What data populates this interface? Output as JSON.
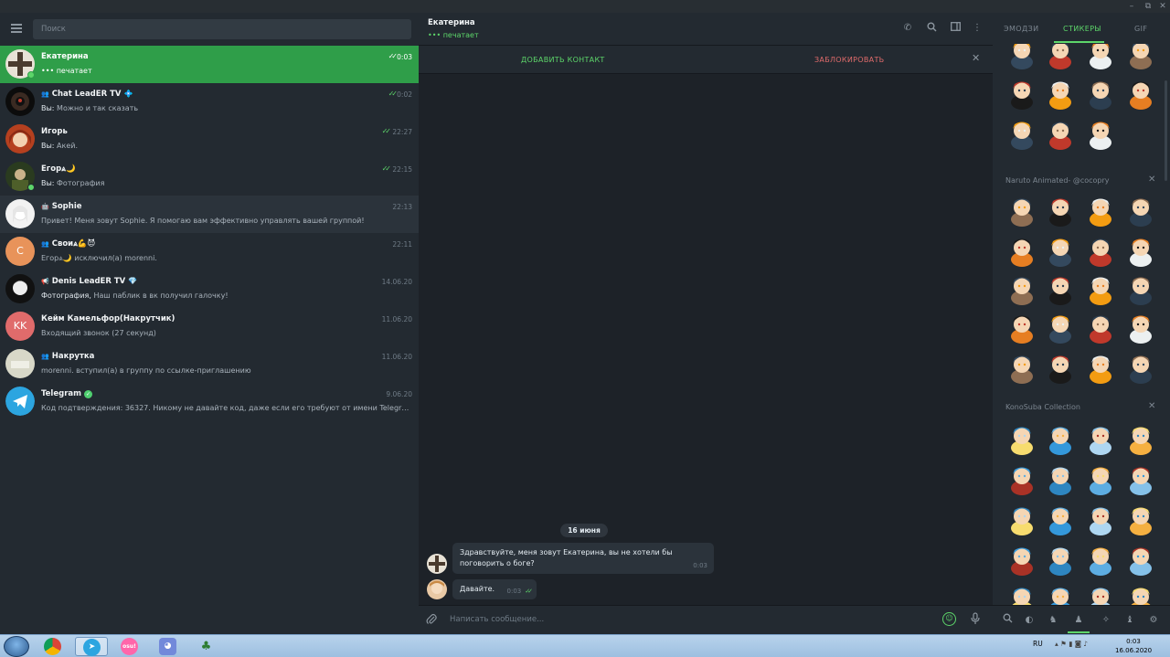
{
  "window": {
    "minimize": "–",
    "maximize": "⧉",
    "close": "✕"
  },
  "sidebar": {
    "search_placeholder": "Поиск",
    "chats": [
      {
        "name": "Екатерина",
        "preview": "••• печатает",
        "time": "0:03",
        "read": true,
        "online": true,
        "active": true,
        "avatar": "cross"
      },
      {
        "name": "Chat LeadER TV",
        "name_suffix": "💠",
        "group": true,
        "preview_me": "Вы:",
        "preview": "Можно и так сказать",
        "time": "0:02",
        "read": true
      },
      {
        "name": "Игорь",
        "preview_me": "Вы:",
        "preview": "Акей.",
        "time": "22:27",
        "read": true
      },
      {
        "name": "Егор⩓🌙",
        "preview_me": "Вы:",
        "preview": "Фотография",
        "time": "22:15",
        "read": true,
        "online": true
      },
      {
        "name": "Sophie",
        "bot": true,
        "preview": "Привет! Меня зовут Sophie. Я помогаю вам эффективно управлять вашей группой!",
        "time": "22:13",
        "hover": true
      },
      {
        "name": "Свои⩓💪😈",
        "group": true,
        "preview": "Егор⩓🌙 исключил(а) morenni.",
        "time": "22:11",
        "avatar_letter": "С",
        "avatar_color": "#e8935a"
      },
      {
        "name": "Denis LeadER TV",
        "name_suffix": "💎",
        "channel": true,
        "preview_me": "Фотография,",
        "preview": "Наш паблик в вк получил галочку!",
        "time": "14.06.20"
      },
      {
        "name": "Кейм Камельфор(Накрутчик)",
        "preview": "Входящий звонок (27 секунд)",
        "time": "11.06.20",
        "avatar_letter": "KK",
        "avatar_color": "#e06b6b"
      },
      {
        "name": "Накрутка",
        "group": true,
        "preview": "morenni. вступил(а) в группу по ссылке-приглашению",
        "time": "11.06.20"
      },
      {
        "name": "Telegram",
        "verified": true,
        "preview": "Код подтверждения: 36327. Никому не давайте код, даже если его требуют от имени Telegram! ...",
        "time": "9.06.20"
      }
    ]
  },
  "chat": {
    "title": "Екатерина",
    "status": "••• печатает",
    "add_contact": "ДОБАВИТЬ КОНТАКТ",
    "block": "ЗАБЛОКИРОВАТЬ",
    "date": "16 июня",
    "messages": [
      {
        "text_1": "Здравствуйте, меня зовут Екатерина, вы не хотели бы",
        "text_2": "поговорить о боге?",
        "time": "0:03"
      },
      {
        "text": "Давайте.",
        "time": "0:03",
        "read": true
      }
    ],
    "composer_placeholder": "Написать сообщение..."
  },
  "stickers": {
    "tabs": [
      "ЭМОДЗИ",
      "СТИКЕРЫ",
      "GIF"
    ],
    "active_tab": "СТИКЕРЫ",
    "packs": [
      "Naruto Animated- @cocopry",
      "KonoSuba Collection"
    ]
  },
  "taskbar": {
    "lang": "RU",
    "time": "0:03",
    "date": "16.06.2020"
  },
  "colors": {
    "accent": "#5dd66a",
    "active_chat": "#2f9e49",
    "danger": "#e06b6b"
  }
}
